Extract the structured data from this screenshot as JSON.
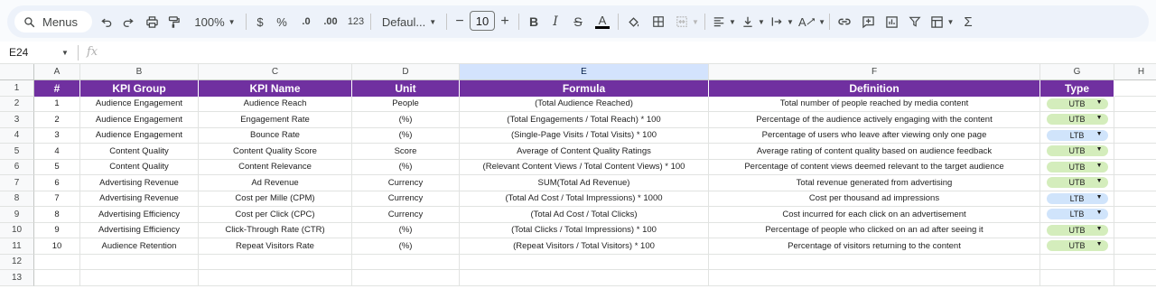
{
  "toolbar": {
    "menus_label": "Menus",
    "zoom": "100%",
    "currency": "$",
    "percent": "%",
    "decrease_decimals": ".0",
    "increase_decimals": ".00",
    "number_format": "123",
    "font_name": "Defaul...",
    "font_size": "10"
  },
  "formula_bar": {
    "name_box": "E24",
    "fx_label": "fx"
  },
  "columns": [
    "A",
    "B",
    "C",
    "D",
    "E",
    "F",
    "G",
    "H"
  ],
  "row_numbers": [
    "1",
    "2",
    "3",
    "4",
    "5",
    "6",
    "7",
    "8",
    "9",
    "10",
    "11",
    "12",
    "13"
  ],
  "table": {
    "headers": [
      "#",
      "KPI Group",
      "KPI Name",
      "Unit",
      "Formula",
      "Definition",
      "Type"
    ],
    "rows": [
      [
        "1",
        "Audience Engagement",
        "Audience Reach",
        "People",
        "(Total Audience Reached)",
        "Total number of people reached by media content",
        "UTB"
      ],
      [
        "2",
        "Audience Engagement",
        "Engagement Rate",
        "(%)",
        "(Total Engagements / Total Reach) * 100",
        "Percentage of the audience actively engaging with the content",
        "UTB"
      ],
      [
        "3",
        "Audience Engagement",
        "Bounce Rate",
        "(%)",
        "(Single-Page Visits / Total Visits) * 100",
        "Percentage of users who leave after viewing only one page",
        "LTB"
      ],
      [
        "4",
        "Content Quality",
        "Content Quality Score",
        "Score",
        "Average of Content Quality Ratings",
        "Average rating of content quality based on audience feedback",
        "UTB"
      ],
      [
        "5",
        "Content Quality",
        "Content Relevance",
        "(%)",
        "(Relevant Content Views / Total Content Views) * 100",
        "Percentage of content views deemed relevant to the target audience",
        "UTB"
      ],
      [
        "6",
        "Advertising Revenue",
        "Ad Revenue",
        "Currency",
        "SUM(Total Ad Revenue)",
        "Total revenue generated from advertising",
        "UTB"
      ],
      [
        "7",
        "Advertising Revenue",
        "Cost per Mille (CPM)",
        "Currency",
        "(Total Ad Cost / Total Impressions) * 1000",
        "Cost per thousand ad impressions",
        "LTB"
      ],
      [
        "8",
        "Advertising Efficiency",
        "Cost per Click (CPC)",
        "Currency",
        "(Total Ad Cost / Total Clicks)",
        "Cost incurred for each click on an advertisement",
        "LTB"
      ],
      [
        "9",
        "Advertising Efficiency",
        "Click-Through Rate (CTR)",
        "(%)",
        "(Total Clicks / Total Impressions) * 100",
        "Percentage of people who clicked on an ad after seeing it",
        "UTB"
      ],
      [
        "10",
        "Audience Retention",
        "Repeat Visitors Rate",
        "(%)",
        "(Repeat Visitors / Total Visitors) * 100",
        "Percentage of visitors returning to the content",
        "UTB"
      ]
    ]
  },
  "colors": {
    "header_bg": "#7030a0",
    "utb_chip": "#d4edbc",
    "ltb_chip": "#d0e4fb",
    "selected_col": "#d3e3fd"
  }
}
